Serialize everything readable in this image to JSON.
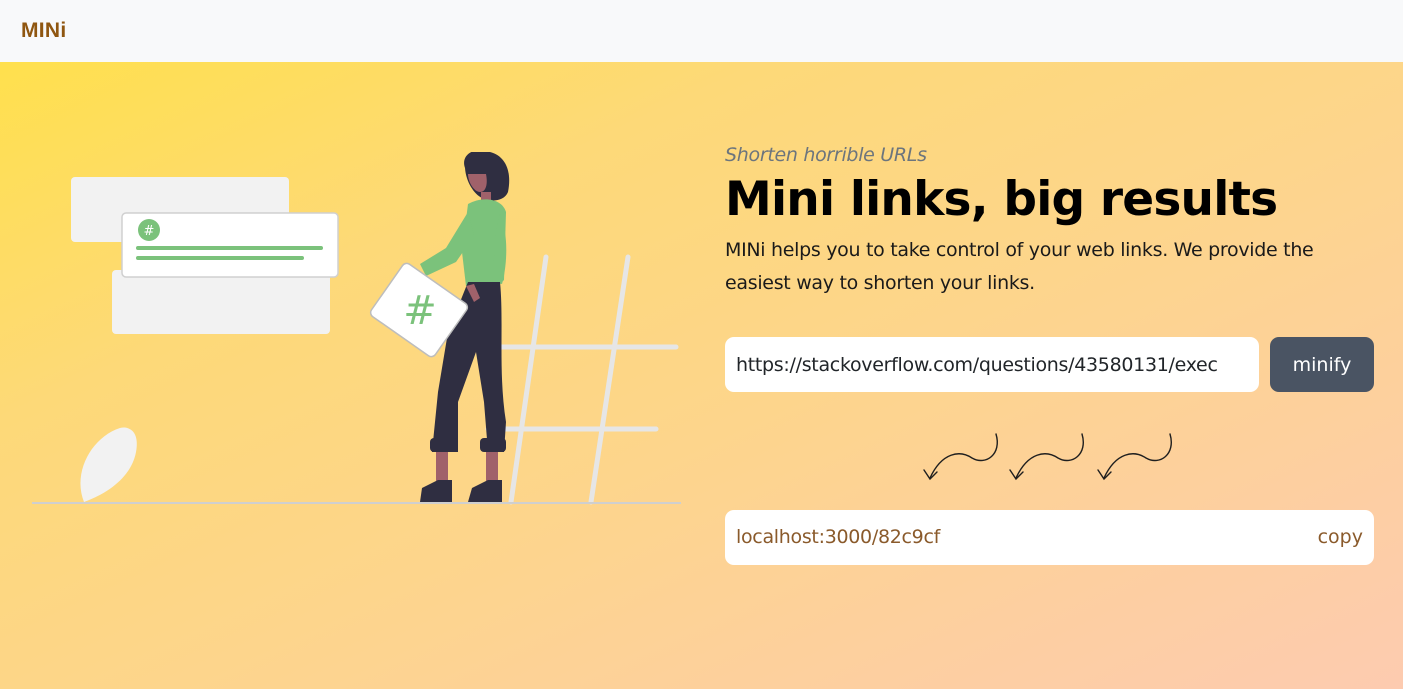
{
  "navbar": {
    "brand": "MINi"
  },
  "hero": {
    "tagline": "Shorten horrible URLs",
    "headline": "Mini links, big results",
    "lead": "MINi helps you to take control of your web links. We provide the easiest way to shorten your links."
  },
  "form": {
    "url_value": "https://stackoverflow.com/questions/43580131/exec",
    "minify_label": "minify"
  },
  "result": {
    "short_url": "localhost:3000/82c9cf",
    "copy_label": "copy"
  },
  "illustration": {
    "hashtag_glyph": "#",
    "icons": [
      "hashtag-badge-icon",
      "hashtag-tablet-icon",
      "leaf-icon"
    ]
  },
  "colors": {
    "brand": "#8f5610",
    "button_bg": "#4a5463",
    "accent_green": "#7bc27b",
    "result_text": "#8a5a2b"
  }
}
